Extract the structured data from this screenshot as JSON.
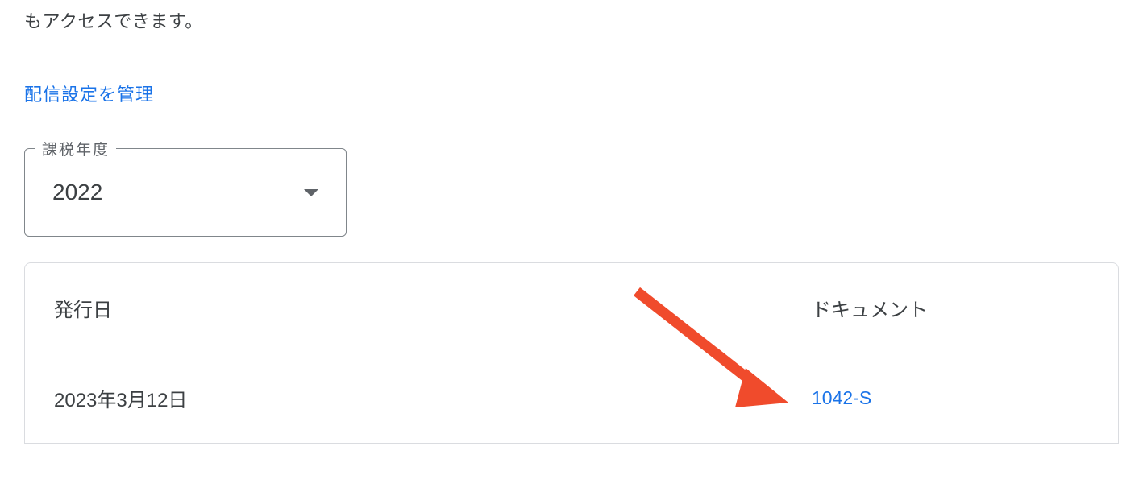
{
  "intro": {
    "line1": "もアクセスできます。"
  },
  "manage_link": "配信設定を管理",
  "dropdown": {
    "label": "課税年度",
    "value": "2022"
  },
  "table": {
    "header": {
      "issue_date": "発行日",
      "document": "ドキュメント"
    },
    "row": {
      "issue_date": "2023年3月12日",
      "document": "1042-S"
    }
  }
}
